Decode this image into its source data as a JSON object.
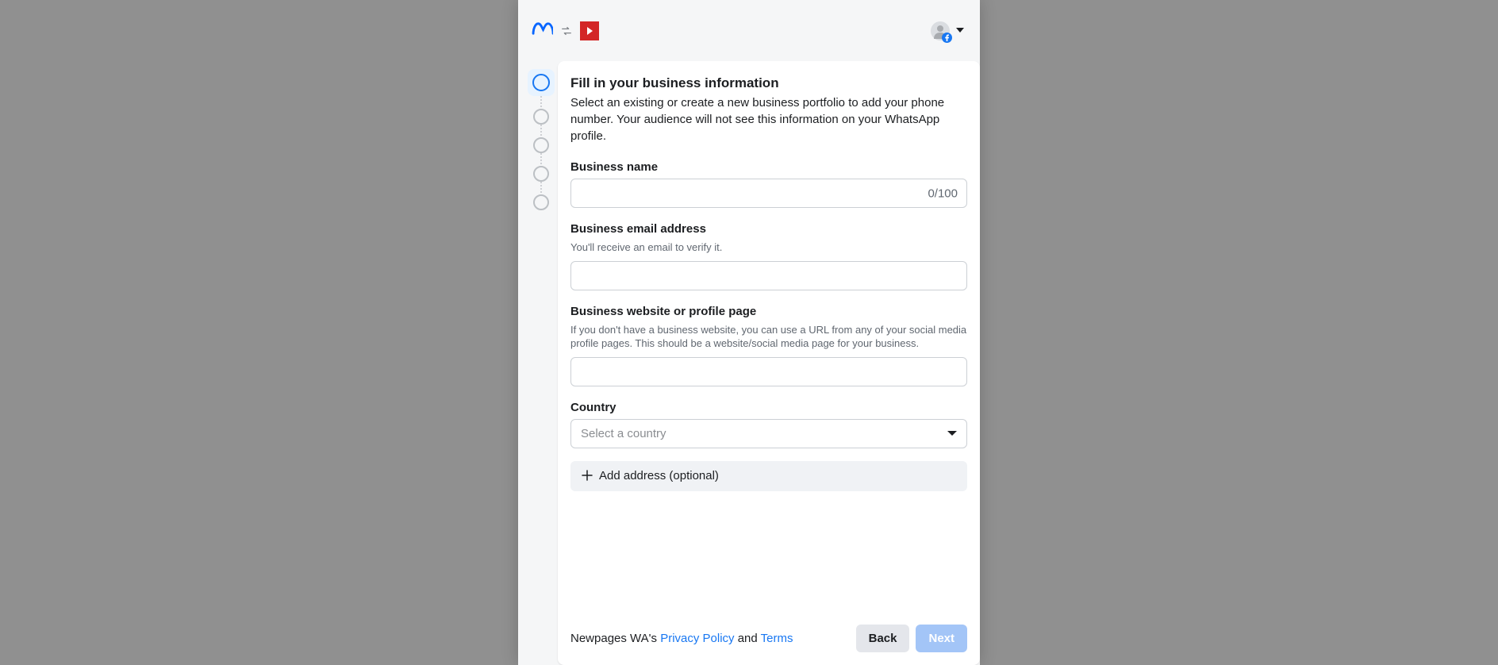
{
  "header": {
    "meta_logo_name": "meta-logo",
    "app_name": "app-logo"
  },
  "stepper": {
    "total": 5,
    "current": 1
  },
  "form": {
    "title": "Fill in your business information",
    "subtitle": "Select an existing or create a new business portfolio to add your phone number. Your audience will not see this information on your WhatsApp profile.",
    "business_name": {
      "label": "Business name",
      "value": "",
      "char_count": "0/100"
    },
    "email": {
      "label": "Business email address",
      "help": "You'll receive an email to verify it.",
      "value": ""
    },
    "website": {
      "label": "Business website or profile page",
      "help": "If you don't have a business website, you can use a URL from any of your social media profile pages. This should be a website/social media page for your business.",
      "value": ""
    },
    "country": {
      "label": "Country",
      "placeholder": "Select a country"
    },
    "add_address_label": "Add address (optional)"
  },
  "footer": {
    "prefix": "Newpages WA's ",
    "privacy": "Privacy Policy",
    "and": " and ",
    "terms": "Terms",
    "back": "Back",
    "next": "Next"
  }
}
